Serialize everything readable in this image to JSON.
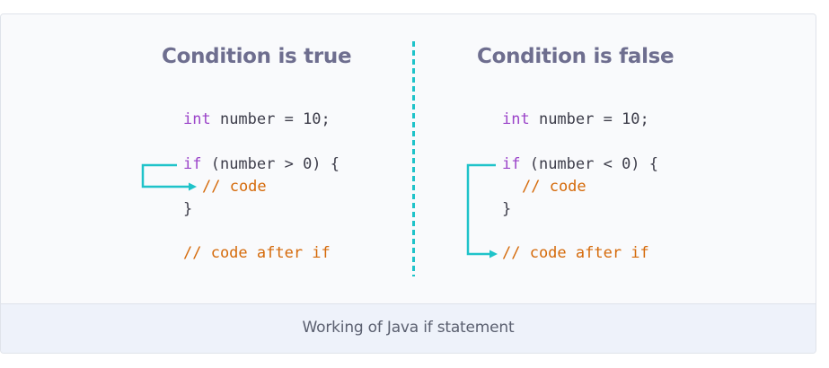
{
  "left_panel": {
    "heading": "Condition is true",
    "line1_kw": "int",
    "line1_rest": " number = 10;",
    "line2_kw": "if",
    "line2_rest": " (number > 0) {",
    "line3_comment": "// code",
    "line4": "}",
    "line5_comment": "// code after if"
  },
  "right_panel": {
    "heading": "Condition is false",
    "line1_kw": "int",
    "line1_rest": " number = 10;",
    "line2_kw": "if",
    "line2_rest": " (number < 0) {",
    "line3_comment": "// code",
    "line4": "}",
    "line5_comment": "// code after if"
  },
  "caption": "Working of Java if statement",
  "colors": {
    "keyword": "#9b44c9",
    "comment": "#d56a0a",
    "arrow": "#1fc3c9",
    "heading": "#6e6e8f"
  }
}
